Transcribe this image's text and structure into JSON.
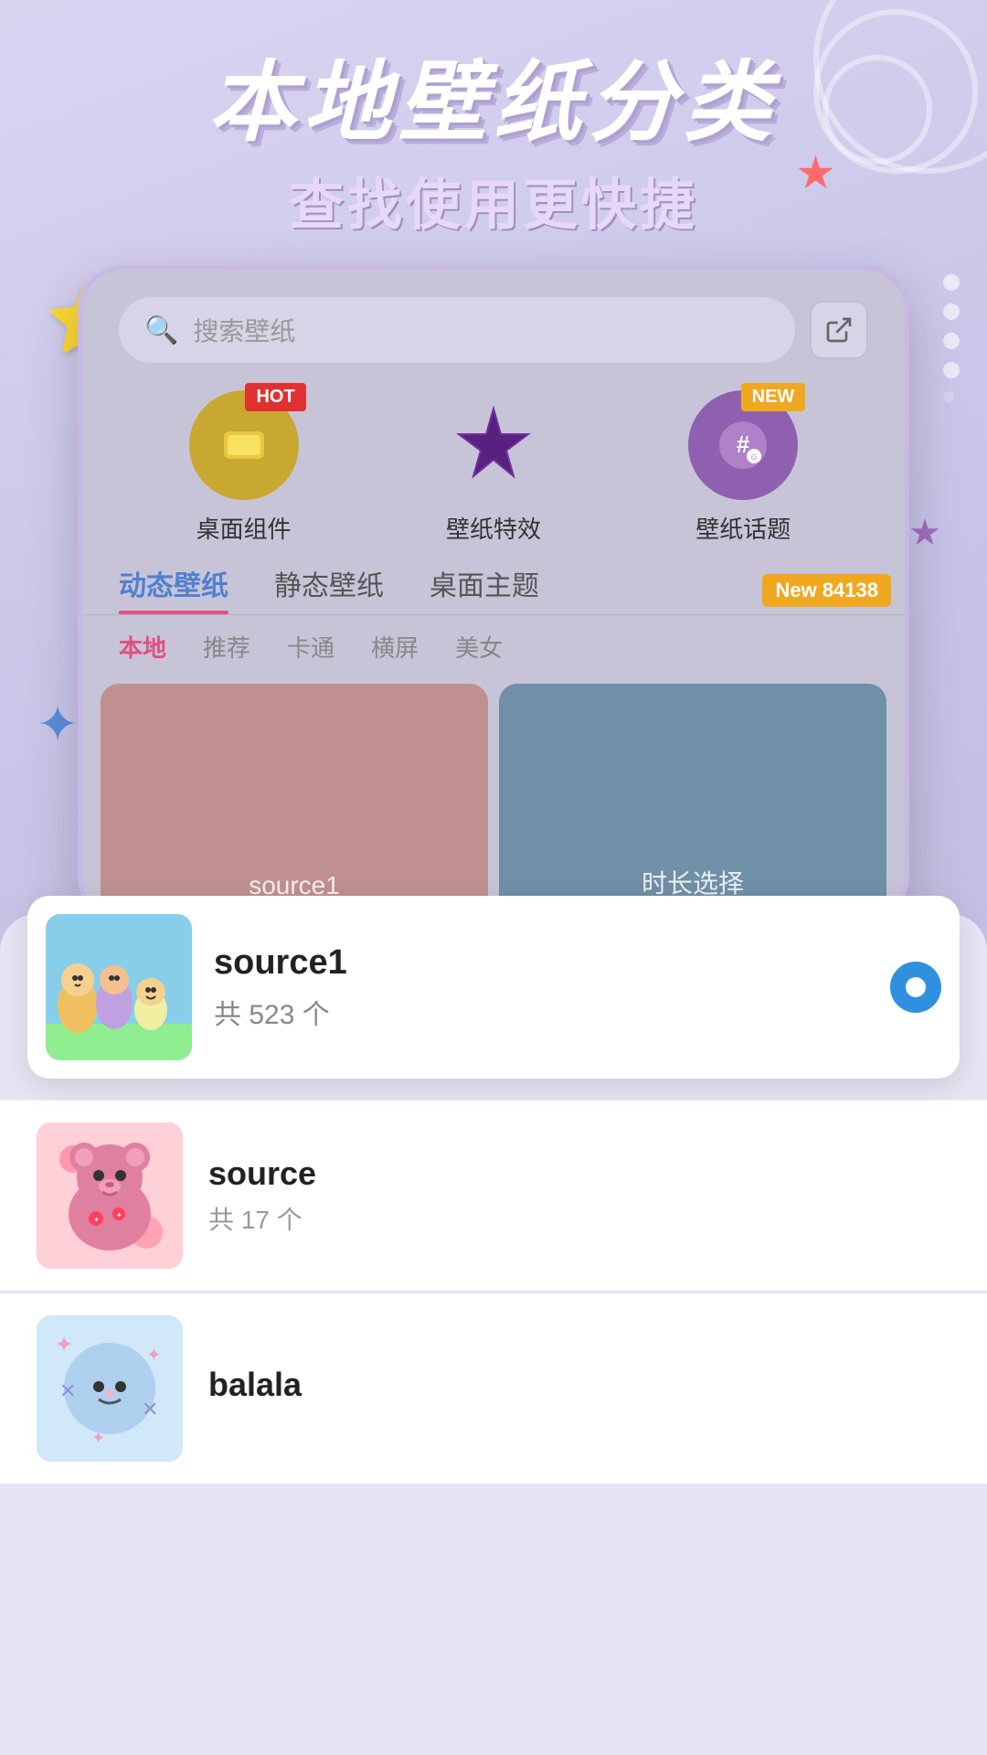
{
  "page": {
    "background_color": "#c8c4e0"
  },
  "header": {
    "main_title": "本地壁纸分类",
    "sub_title": "查找使用更快捷"
  },
  "decorations": {
    "star_yellow": "⭐",
    "star_red": "★",
    "star_purple": "★",
    "star_blue": "☆"
  },
  "phone": {
    "search": {
      "placeholder": "搜索壁纸",
      "icon": "🔍"
    },
    "categories": [
      {
        "id": "desk",
        "label": "桌面组件",
        "badge": "HOT",
        "badge_type": "hot",
        "icon": "🪟"
      },
      {
        "id": "effect",
        "label": "壁纸特效",
        "badge": null,
        "icon": "✦"
      },
      {
        "id": "topic",
        "label": "壁纸话题",
        "badge": "NEW",
        "badge_type": "new",
        "icon": "#"
      }
    ],
    "main_tabs": [
      {
        "id": "dynamic",
        "label": "动态壁纸",
        "active": true
      },
      {
        "id": "static",
        "label": "静态壁纸",
        "active": false
      },
      {
        "id": "desktop",
        "label": "桌面主题",
        "active": false
      }
    ],
    "sub_tabs": [
      {
        "id": "local",
        "label": "本地",
        "active": true
      },
      {
        "id": "recommend",
        "label": "推荐",
        "active": false
      },
      {
        "id": "cartoon",
        "label": "卡通",
        "active": false
      },
      {
        "id": "landscape",
        "label": "横屏",
        "active": false
      },
      {
        "id": "beauty",
        "label": "美女",
        "active": false
      }
    ],
    "grid_items": [
      {
        "id": "source1",
        "label": "source1",
        "color": "#c09090"
      },
      {
        "id": "duration",
        "label": "时长选择",
        "color": "#7090a8"
      }
    ]
  },
  "list": {
    "items": [
      {
        "id": "source1",
        "name": "source1",
        "count": "共 523 个",
        "selected": true,
        "thumb_emoji": "👨‍👩‍👧"
      },
      {
        "id": "source",
        "name": "source",
        "count": "共 17 个",
        "selected": false,
        "thumb_emoji": "🐻"
      },
      {
        "id": "balala",
        "name": "balala",
        "count": "",
        "selected": false,
        "thumb_emoji": "🎀"
      }
    ]
  },
  "new_badge": "New 84138"
}
